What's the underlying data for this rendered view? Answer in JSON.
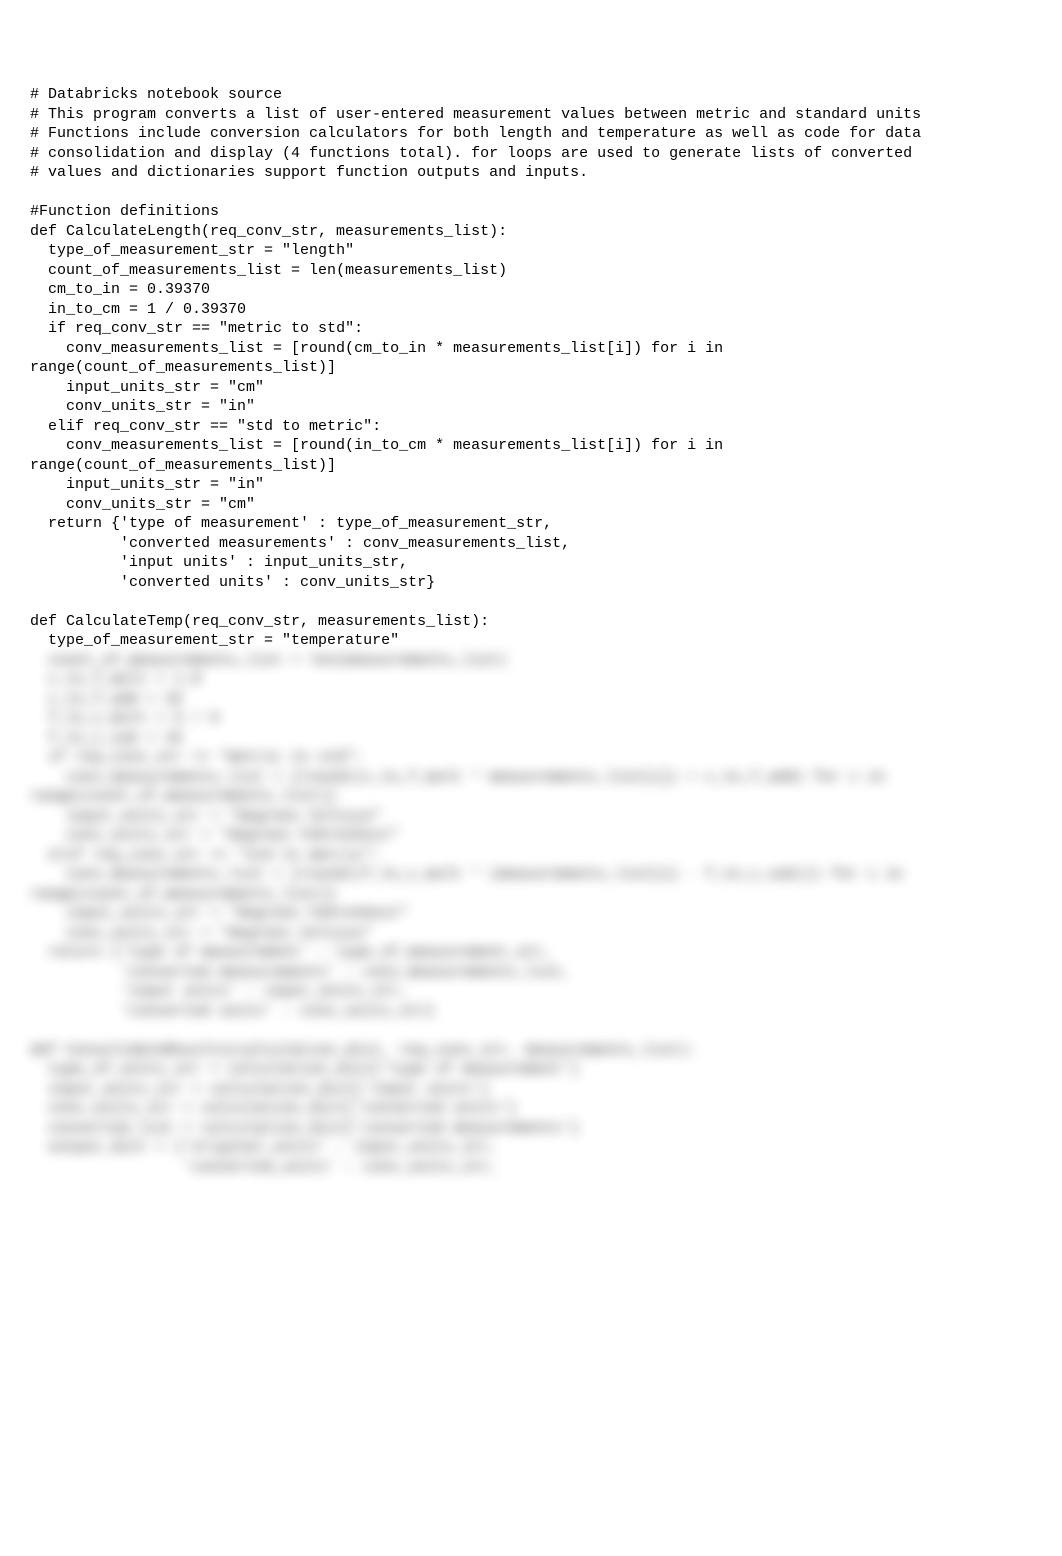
{
  "code": {
    "visible": "# Databricks notebook source\n# This program converts a list of user-entered measurement values between metric and standard units\n# Functions include conversion calculators for both length and temperature as well as code for data\n# consolidation and display (4 functions total). for loops are used to generate lists of converted\n# values and dictionaries support function outputs and inputs.\n\n#Function definitions\ndef CalculateLength(req_conv_str, measurements_list):\n  type_of_measurement_str = \"length\"\n  count_of_measurements_list = len(measurements_list)\n  cm_to_in = 0.39370\n  in_to_cm = 1 / 0.39370\n  if req_conv_str == \"metric to std\":\n    conv_measurements_list = [round(cm_to_in * measurements_list[i]) for i in range(count_of_measurements_list)]\n    input_units_str = \"cm\"\n    conv_units_str = \"in\"\n  elif req_conv_str == \"std to metric\":\n    conv_measurements_list = [round(in_to_cm * measurements_list[i]) for i in range(count_of_measurements_list)]\n    input_units_str = \"in\"\n    conv_units_str = \"cm\"\n  return {'type of measurement' : type_of_measurement_str,\n          'converted measurements' : conv_measurements_list,\n          'input units' : input_units_str,\n          'converted units' : conv_units_str}\n\ndef CalculateTemp(req_conv_str, measurements_list):\n  type_of_measurement_str = \"temperature\"",
    "blurred": "  count_of_measurements_list = len(measurements_list)\n  c_to_f_mult = 1.8\n  c_to_f_add = 32\n  f_to_c_mult = 5 / 9\n  f_to_c_sub = 32\n  if req_conv_str == \"metric to std\":\n    conv_measurements_list = [round((c_to_f_mult * measurements_list[i]) + c_to_f_add) for i in range(count_of_measurements_list)]\n    input_units_str = \"degrees Celsius\"\n    conv_units_str = \"degrees Fahrenheit\"\n  elif req_conv_str == \"std to metric\":\n    conv_measurements_list = [round((f_to_c_mult * (measurements_list[i] - f_to_c_sub))) for i in range(count_of_measurements_list)]\n    input_units_str = \"degrees Fahrenheit\"\n    conv_units_str = \"degrees Celsius\"\n  return {'type of measurement' : type_of_measurement_str,\n          'converted measurements' : conv_measurements_list,\n          'input units' : input_units_str,\n          'converted units' : conv_units_str}\n\ndef ConsolidateResults(calculation_dict, req_conv_str, measurements_list):\n  type_of_units_str = calculation_dict['type of measurement']\n  input_units_str = calculation_dict['input units']\n  conv_units_str = calculation_dict['converted units']\n  converted_list = calculation_dict['converted measurements']\n  output_dict = {'original_units' : input_units_str,\n                 'converted_units' : conv_units_str,"
  }
}
